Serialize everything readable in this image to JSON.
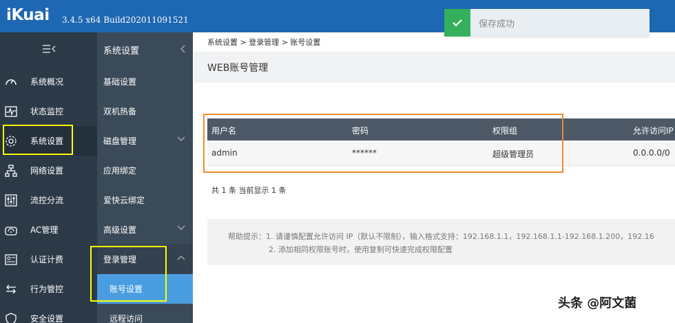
{
  "header": {
    "logo": "iKuai",
    "version": "3.4.5 x64 Build202011091521"
  },
  "toast": {
    "text": "保存成功"
  },
  "nav1": {
    "items": [
      {
        "label": "系统概况",
        "icon": "gauge-icon"
      },
      {
        "label": "状态监控",
        "icon": "pulse-icon"
      },
      {
        "label": "系统设置",
        "icon": "gear-icon"
      },
      {
        "label": "网络设置",
        "icon": "network-icon"
      },
      {
        "label": "流控分流",
        "icon": "sliders-icon"
      },
      {
        "label": "AC管理",
        "icon": "wifi-router-icon"
      },
      {
        "label": "认证计费",
        "icon": "id-card-icon"
      },
      {
        "label": "行为管控",
        "icon": "arrows-icon"
      },
      {
        "label": "安全设置",
        "icon": "shield-icon"
      }
    ]
  },
  "nav2": {
    "title": "系统设置",
    "items": [
      {
        "label": "基础设置"
      },
      {
        "label": "双机热备"
      },
      {
        "label": "磁盘管理"
      },
      {
        "label": "应用绑定"
      },
      {
        "label": "爱快云绑定"
      },
      {
        "label": "高级设置"
      },
      {
        "label": "登录管理"
      },
      {
        "label": "账号设置"
      },
      {
        "label": "远程访问"
      }
    ]
  },
  "breadcrumb": "系统设置 > 登录管理 > 账号设置",
  "page_title": "WEB账号管理",
  "table": {
    "headers": [
      "用户名",
      "密码",
      "权限组",
      "允许访问IP"
    ],
    "rows": [
      [
        "admin",
        "******",
        "超级管理员",
        "0.0.0.0/0"
      ]
    ]
  },
  "count_text": "共 1 条 当前显示 1 条",
  "help": {
    "line1": "帮助提示：1. 请谨慎配置允许访问 IP（默认不限制），输入格式支持：192.168.1.1，192.168.1.1-192.168.1.200，192.16",
    "line2": "2. 添加相同权限账号时，使用复制可快速完成权限配置"
  },
  "watermark": "头条 @阿文菌",
  "colors": {
    "topbar": "#1e67b2",
    "nav1_bg": "#2c3a48",
    "nav2_bg": "#3b4a58",
    "selected": "#4a9ee0",
    "table_header": "#4d5967",
    "toast_green": "#34b05c",
    "highlight_yellow": "#ffff00",
    "highlight_orange": "#f28a30"
  }
}
